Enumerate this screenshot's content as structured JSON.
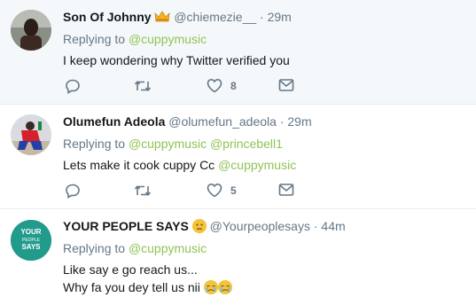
{
  "tweets": [
    {
      "name": "Son Of Johnny",
      "handle": "@chiemezie__",
      "time": "29m",
      "replying_label": "Replying to",
      "mentions": [
        "@cuppymusic"
      ],
      "text": "I keep wondering why Twitter verified you",
      "likes": "8"
    },
    {
      "name": "Olumefun Adeola",
      "handle": "@olumefun_adeola",
      "time": "29m",
      "replying_label": "Replying to",
      "mentions": [
        "@cuppymusic",
        "@princebell1"
      ],
      "text": "Lets make it cook cuppy Cc",
      "text_mention": "@cuppymusic",
      "likes": "5"
    },
    {
      "name": "YOUR PEOPLE SAYS",
      "handle": "@Yourpeoplesays",
      "time": "44m",
      "replying_label": "Replying to",
      "mentions": [
        "@cuppymusic"
      ],
      "text_line1": "Like say e go reach us...",
      "text_line2": "Why fa you dey tell us nii",
      "avatar_text": [
        "YOUR",
        "PEOPLE",
        "SAYS"
      ]
    }
  ],
  "dot": "·",
  "colors": {
    "mention": "#8fc454",
    "muted": "#657786",
    "avatar3": "#2a9d8f"
  },
  "icons": [
    "reply-icon",
    "retweet-icon",
    "like-icon",
    "direct-message-icon",
    "crown-emoji-icon",
    "neutral-face-emoji-icon",
    "crying-face-emoji-icon"
  ]
}
